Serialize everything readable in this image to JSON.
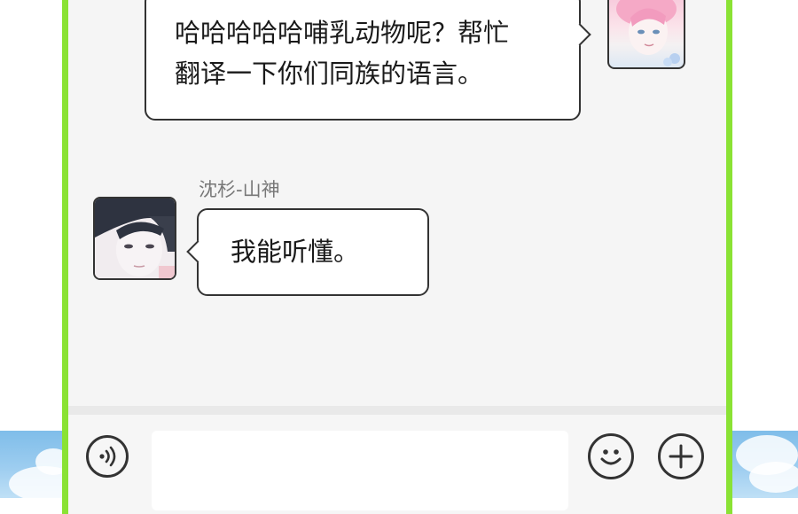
{
  "chat": {
    "messages": [
      {
        "side": "right",
        "text_line1": "哈哈哈哈哈哺乳动物呢？帮忙",
        "text_line2": "翻译一下你们同族的语言。"
      },
      {
        "side": "left",
        "sender": "沈杉-山神",
        "text": "我能听懂。"
      }
    ]
  },
  "input_bar": {
    "voice_icon": "voice-icon",
    "emoji_icon": "smiley-icon",
    "plus_icon": "plus-icon",
    "text_value": ""
  },
  "colors": {
    "frame_border": "#8ae234",
    "chat_background": "#f5f5f5",
    "bubble_background": "#ffffff",
    "sky": "#8fc6ee"
  }
}
